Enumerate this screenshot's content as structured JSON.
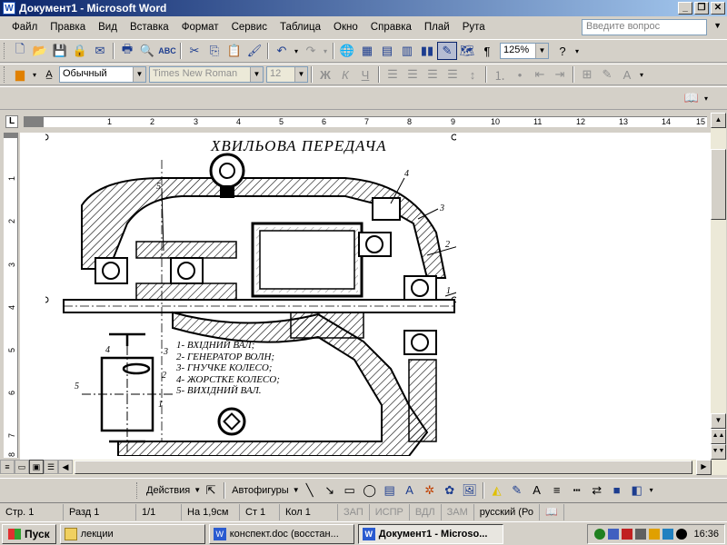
{
  "window": {
    "title": "Документ1 - Microsoft Word",
    "app_icon": "word-icon"
  },
  "menu": {
    "items": [
      "Файл",
      "Правка",
      "Вид",
      "Вставка",
      "Формат",
      "Сервис",
      "Таблица",
      "Окно",
      "Справка",
      "Плай",
      "Рута"
    ],
    "help_placeholder": "Введите вопрос"
  },
  "standard_toolbar": {
    "zoom": "125%"
  },
  "formatting_toolbar": {
    "style": "Обычный",
    "font": "Times New Roman",
    "size": "12",
    "bold": "Ж",
    "italic": "К",
    "underline": "Ч"
  },
  "ruler": {
    "h_numbers": [
      "1",
      "2",
      "3",
      "4",
      "5",
      "6",
      "7",
      "8",
      "9",
      "10",
      "11",
      "12",
      "13",
      "14",
      "15"
    ],
    "v_numbers": [
      "1",
      "2",
      "3",
      "4",
      "5",
      "6",
      "7",
      "8"
    ]
  },
  "document": {
    "title": "ХВИЛЬОВА  ПЕРЕДАЧА",
    "legend": [
      "1- ВХІДНИЙ ВАЛ;",
      "2- ГЕНЕРАТОР ВОЛН;",
      "3- ГНУЧКЕ КОЛЕСО;",
      "4- ЖОРСТКЕ КОЛЕСО;",
      "5- ВИХІДНИЙ ВАЛ."
    ],
    "drawing_labels": [
      "5",
      "4",
      "3",
      "2",
      "1",
      "4",
      "3",
      "2",
      "1",
      "5"
    ]
  },
  "drawing_toolbar": {
    "actions": "Действия",
    "autoshapes": "Автофигуры"
  },
  "status": {
    "page": "Стр.  1",
    "section": "Разд  1",
    "pages": "1/1",
    "at": "На 1,9см",
    "line": "Ст  1",
    "col": "Кол  1",
    "rec": "ЗАП",
    "trk": "ИСПР",
    "ext": "ВДЛ",
    "ovr": "ЗАМ",
    "lang": "русский (Ро"
  },
  "taskbar": {
    "start": "Пуск",
    "tasks": [
      "лекции",
      "конспект.doc (восстан...",
      "Документ1 - Microso..."
    ],
    "clock": "16:36"
  }
}
